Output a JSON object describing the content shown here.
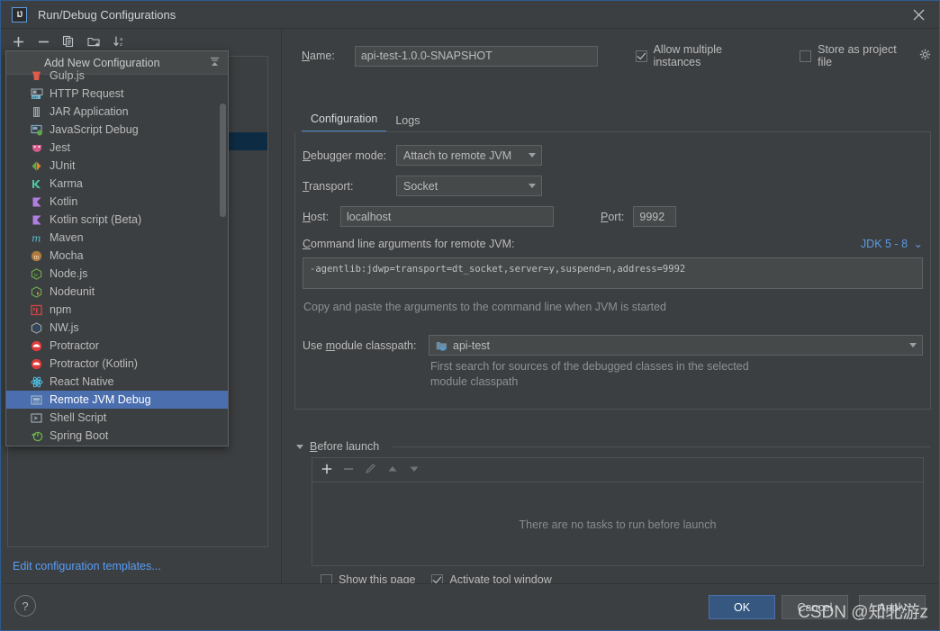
{
  "window": {
    "title": "Run/Debug Configurations",
    "app_badge": "IJ",
    "close_icon": "close-icon"
  },
  "left_panel": {
    "toolbar": [
      {
        "name": "add-configuration-button",
        "icon": "plus-icon"
      },
      {
        "name": "remove-configuration-button",
        "icon": "minus-icon"
      },
      {
        "name": "copy-configuration-button",
        "icon": "copy-icon"
      },
      {
        "name": "new-folder-button",
        "icon": "folder-add-icon"
      },
      {
        "name": "sort-configurations-button",
        "icon": "sort-az-icon"
      }
    ],
    "edit_templates_link": "Edit configuration templates..."
  },
  "popup": {
    "header": "Add New Configuration",
    "header_icon": "collapse-expand-icon",
    "items": [
      {
        "label": "Gulp.js",
        "icon": "gulp-icon",
        "color": "#e15b4a",
        "selected": false
      },
      {
        "label": "HTTP Request",
        "icon": "http-request-icon",
        "color": "#6fb7cf",
        "selected": false
      },
      {
        "label": "JAR Application",
        "icon": "jar-icon",
        "color": "#9aa7b0",
        "selected": false
      },
      {
        "label": "JavaScript Debug",
        "icon": "javascript-debug-icon",
        "color": "#7fa8c2",
        "selected": false
      },
      {
        "label": "Jest",
        "icon": "jest-icon",
        "color": "#d35b8c",
        "selected": false
      },
      {
        "label": "JUnit",
        "icon": "junit-icon",
        "color": "#4fa05a",
        "selected": false
      },
      {
        "label": "Karma",
        "icon": "karma-icon",
        "color": "#4ec9a0",
        "selected": false
      },
      {
        "label": "Kotlin",
        "icon": "kotlin-icon",
        "color": "#b07de0",
        "selected": false
      },
      {
        "label": "Kotlin script (Beta)",
        "icon": "kotlin-script-icon",
        "color": "#b07de0",
        "selected": false
      },
      {
        "label": "Maven",
        "icon": "maven-icon",
        "color": "#57bcd0",
        "selected": false
      },
      {
        "label": "Mocha",
        "icon": "mocha-icon",
        "color": "#b07a3f",
        "selected": false
      },
      {
        "label": "Node.js",
        "icon": "nodejs-icon",
        "color": "#6cb04a",
        "selected": false
      },
      {
        "label": "Nodeunit",
        "icon": "nodeunit-icon",
        "color": "#6cb04a",
        "selected": false
      },
      {
        "label": "npm",
        "icon": "npm-icon",
        "color": "#d14545",
        "selected": false
      },
      {
        "label": "NW.js",
        "icon": "nwjs-icon",
        "color": "#9aa7b0",
        "selected": false
      },
      {
        "label": "Protractor",
        "icon": "protractor-icon",
        "color": "#e03b3b",
        "selected": false
      },
      {
        "label": "Protractor (Kotlin)",
        "icon": "protractor-kotlin-icon",
        "color": "#e03b3b",
        "selected": false
      },
      {
        "label": "React Native",
        "icon": "react-native-icon",
        "color": "#4fc3e8",
        "selected": false
      },
      {
        "label": "Remote JVM Debug",
        "icon": "remote-jvm-debug-icon",
        "color": "#9fb6c8",
        "selected": true
      },
      {
        "label": "Shell Script",
        "icon": "shell-script-icon",
        "color": "#9aa7b0",
        "selected": false
      },
      {
        "label": "Spring Boot",
        "icon": "spring-boot-icon",
        "color": "#6cb04a",
        "selected": false
      }
    ]
  },
  "form": {
    "name_label": "Name:",
    "name_value": "api-test-1.0.0-SNAPSHOT",
    "allow_multiple_instances": {
      "label": "Allow multiple instances",
      "checked": true
    },
    "store_as_project_file": {
      "label": "Store as project file",
      "checked": false,
      "gear_icon": "gear-icon"
    },
    "tabs": [
      {
        "label": "Configuration",
        "active": true
      },
      {
        "label": "Logs",
        "active": false
      }
    ],
    "debugger_mode": {
      "label": "Debugger mode:",
      "value": "Attach to remote JVM"
    },
    "transport": {
      "label": "Transport:",
      "value": "Socket"
    },
    "host": {
      "label": "Host:",
      "value": "localhost"
    },
    "port": {
      "label": "Port:",
      "value": "9992"
    },
    "command_line": {
      "label": "Command line arguments for remote JVM:",
      "jdk_selector": "JDK 5 - 8",
      "value": "-agentlib:jdwp=transport=dt_socket,server=y,suspend=n,address=9992",
      "hint": "Copy and paste the arguments to the command line when JVM is started"
    },
    "module_classpath": {
      "label": "Use module classpath:",
      "value": "api-test",
      "icon": "module-icon",
      "hint_line1": "First search for sources of the debugged classes in the selected",
      "hint_line2": "module classpath"
    }
  },
  "before_launch": {
    "title": "Before launch",
    "toolbar": [
      {
        "name": "add-task-button",
        "icon": "plus-icon"
      },
      {
        "name": "remove-task-button",
        "icon": "minus-icon"
      },
      {
        "name": "edit-task-button",
        "icon": "pencil-icon"
      },
      {
        "name": "move-task-up-button",
        "icon": "arrow-up-icon"
      },
      {
        "name": "move-task-down-button",
        "icon": "arrow-down-icon"
      }
    ],
    "empty_text": "There are no tasks to run before launch",
    "show_this_page": {
      "label": "Show this page",
      "checked": false
    },
    "activate_tool_window": {
      "label": "Activate tool window",
      "checked": true
    }
  },
  "footer": {
    "help_label": "?",
    "ok_label": "OK",
    "cancel_label": "Cancel",
    "apply_label": "Apply"
  },
  "watermark": "CSDN @知北游z",
  "colors": {
    "accent": "#4b6eaf",
    "link": "#589df6",
    "background": "#3c3f41",
    "field": "#45494a"
  }
}
